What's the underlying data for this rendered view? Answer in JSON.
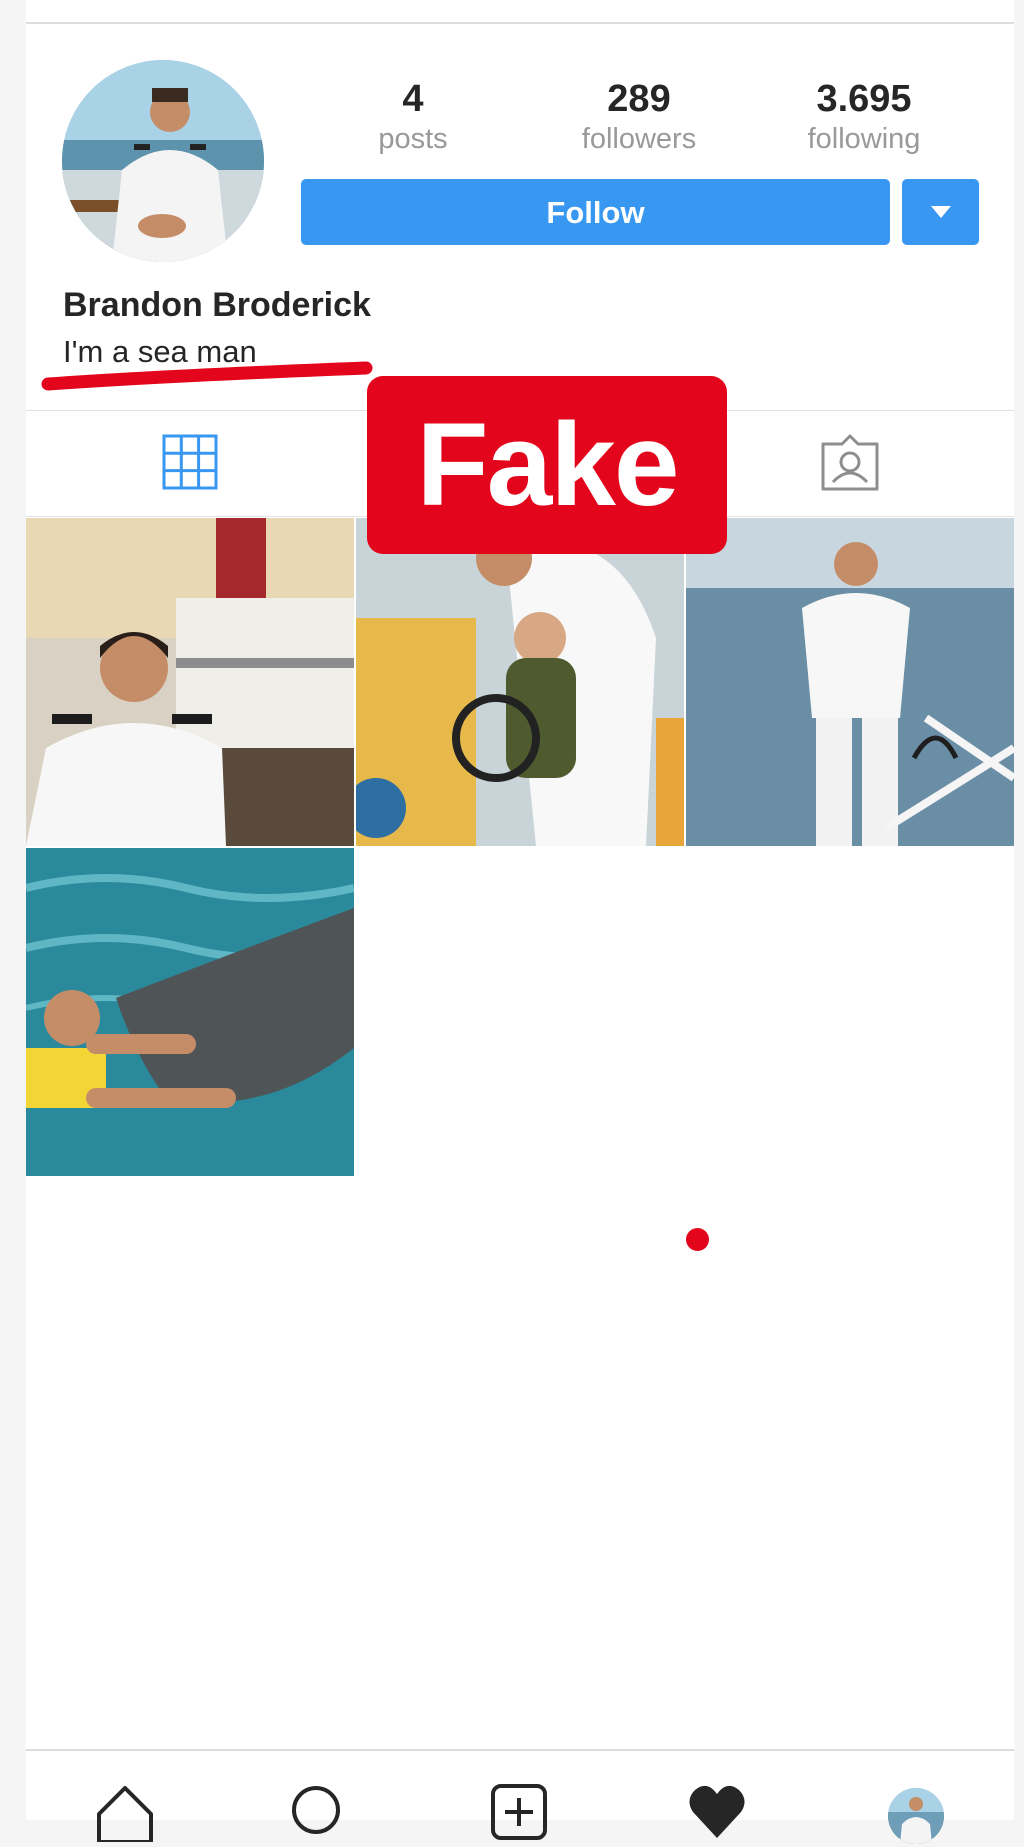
{
  "profile": {
    "name": "Brandon Broderick",
    "bio": "I'm a sea man"
  },
  "stats": {
    "posts": {
      "value": "4",
      "label": "posts"
    },
    "followers": {
      "value": "289",
      "label": "followers"
    },
    "following": {
      "value": "3.695",
      "label": "following"
    }
  },
  "actions": {
    "follow_label": "Follow",
    "dropdown_icon": "chevron-down-icon"
  },
  "tabs": [
    {
      "name": "grid",
      "icon": "grid-icon",
      "active": true
    },
    {
      "name": "tagged",
      "icon": "tagged-icon",
      "active": false
    }
  ],
  "overlay": {
    "stamp_text": "Fake"
  },
  "posts": [
    {
      "icon": "photo"
    },
    {
      "icon": "photo"
    },
    {
      "icon": "photo"
    },
    {
      "icon": "photo"
    }
  ],
  "bottom_nav": [
    {
      "icon": "home-icon"
    },
    {
      "icon": "search-icon"
    },
    {
      "icon": "add-icon"
    },
    {
      "icon": "heart-icon"
    },
    {
      "icon": "profile-avatar"
    }
  ],
  "colors": {
    "accent": "#3897f0",
    "stamp": "#e3051b",
    "text": "#262626",
    "muted": "#999999"
  }
}
